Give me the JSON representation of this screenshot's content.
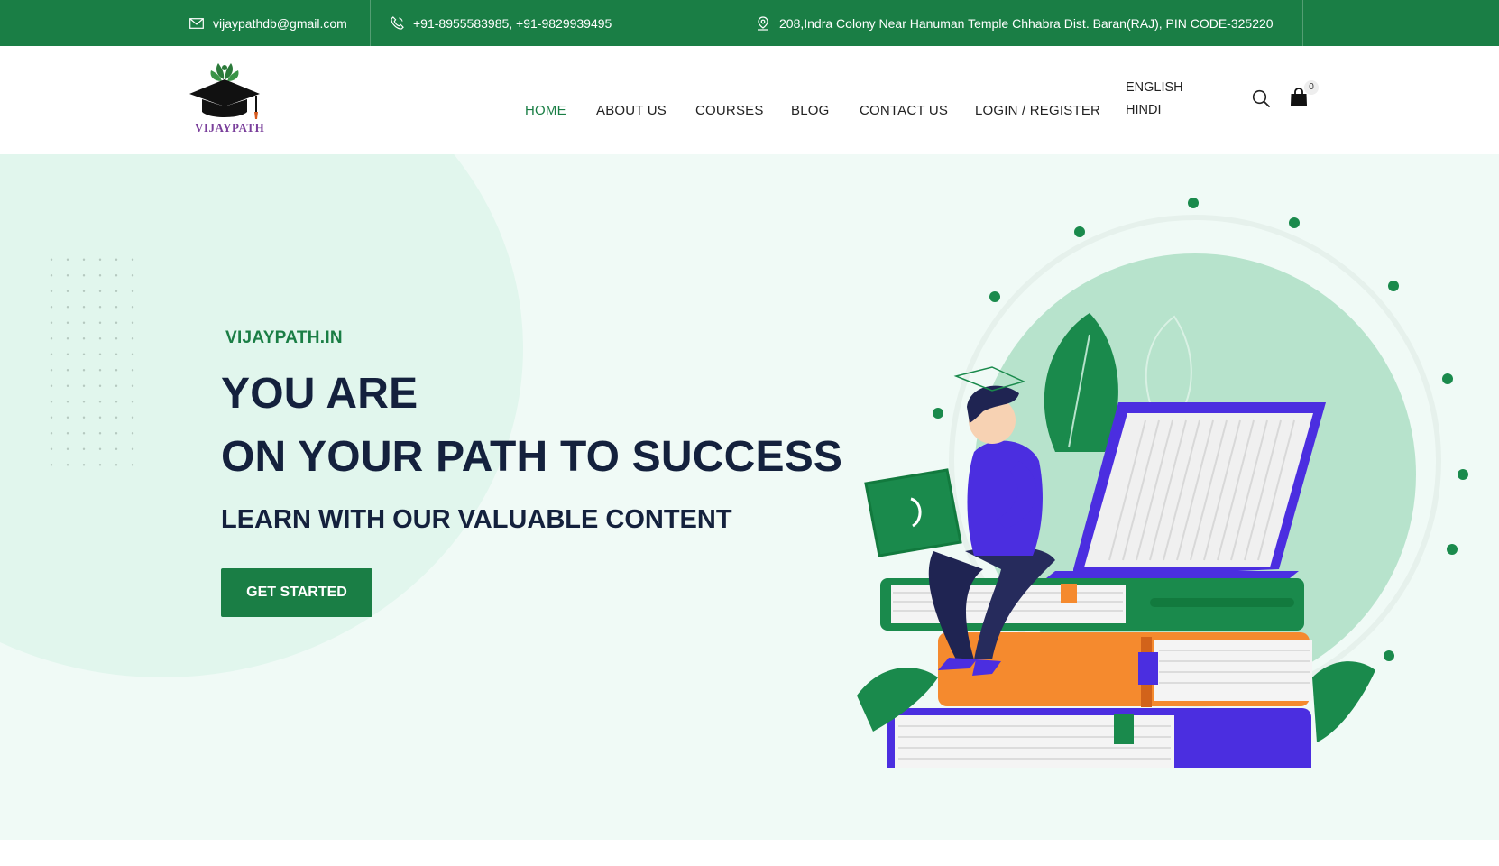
{
  "topbar": {
    "email": "vijaypathdb@gmail.com",
    "phone": "+91-8955583985, +91-9829939495",
    "address": "208,Indra Colony Near Hanuman Temple Chhabra Dist. Baran(RAJ), PIN CODE-325220"
  },
  "header": {
    "logo_text": "VIJAYPATH",
    "nav": [
      {
        "label": "HOME",
        "active": true
      },
      {
        "label": "ABOUT US"
      },
      {
        "label": "COURSES"
      },
      {
        "label": "BLOG"
      },
      {
        "label": "CONTACT US"
      },
      {
        "label": "LOGIN / REGISTER"
      }
    ],
    "languages": [
      "ENGLISH",
      "HINDI"
    ],
    "cart_count": "0",
    "icons": {
      "search": "search-icon",
      "cart": "shopping-bag-icon"
    }
  },
  "hero": {
    "kicker": "VIJAYPATH.IN",
    "title_line1": "YOU ARE",
    "title_line2": "ON YOUR PATH TO SUCCESS",
    "subtitle": "LEARN WITH OUR VALUABLE CONTENT",
    "cta": "GET STARTED"
  },
  "colors": {
    "brand_green": "#1a7e45",
    "heading_navy": "#14213d",
    "hero_bg": "#f0faf6",
    "accent_purple": "#4b2ee0",
    "accent_orange": "#f58a2e"
  }
}
